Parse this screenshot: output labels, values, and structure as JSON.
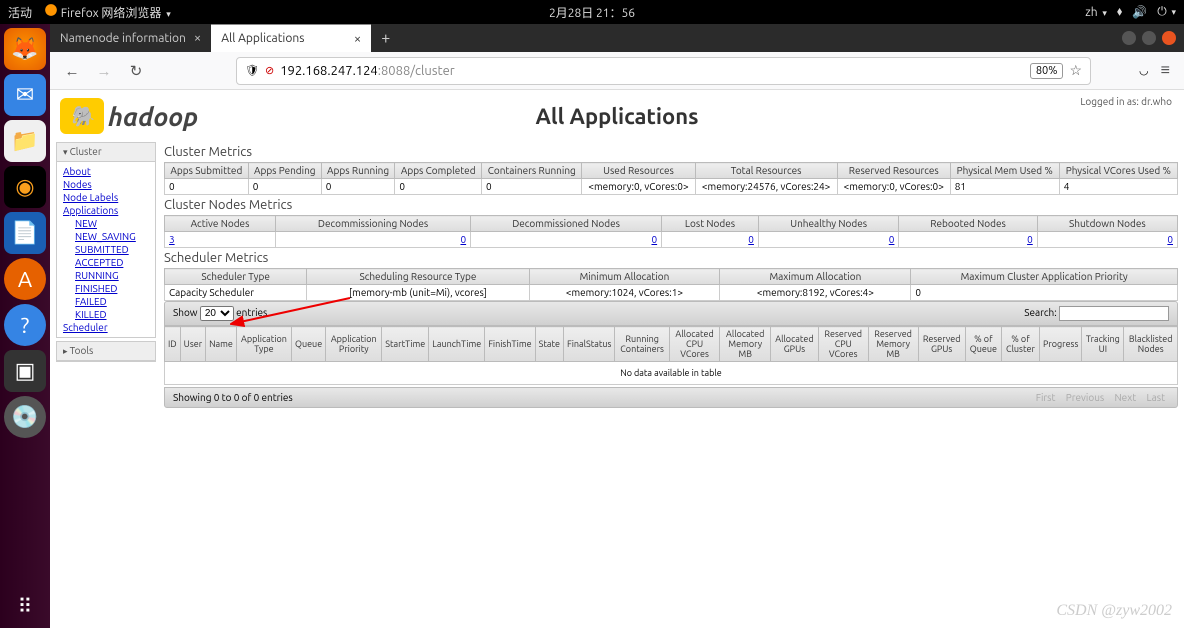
{
  "topbar": {
    "activities": "活动",
    "app_label": "Firefox 网络浏览器",
    "datetime": "2月28日  21：56",
    "lang": "zh"
  },
  "tabs": [
    {
      "title": "Namenode information",
      "active": false
    },
    {
      "title": "All Applications",
      "active": true
    }
  ],
  "url": {
    "host": "192.168.247.124",
    "port_path": ":8088/cluster",
    "zoom": "80%"
  },
  "login_info": "Logged in as: dr.who",
  "page_title": "All Applications",
  "sidebar": {
    "cluster_head": "Cluster",
    "links": [
      "About",
      "Nodes",
      "Node Labels",
      "Applications"
    ],
    "app_states": [
      "NEW",
      "NEW_SAVING",
      "SUBMITTED",
      "ACCEPTED",
      "RUNNING",
      "FINISHED",
      "FAILED",
      "KILLED"
    ],
    "scheduler": "Scheduler",
    "tools_head": "Tools"
  },
  "cluster_metrics": {
    "title": "Cluster Metrics",
    "headers": [
      "Apps Submitted",
      "Apps Pending",
      "Apps Running",
      "Apps Completed",
      "Containers Running",
      "Used Resources",
      "Total Resources",
      "Reserved Resources",
      "Physical Mem Used %",
      "Physical VCores Used %"
    ],
    "values": [
      "0",
      "0",
      "0",
      "0",
      "0",
      "<memory:0, vCores:0>",
      "<memory:24576, vCores:24>",
      "<memory:0, vCores:0>",
      "81",
      "4"
    ]
  },
  "nodes_metrics": {
    "title": "Cluster Nodes Metrics",
    "headers": [
      "Active Nodes",
      "Decommissioning Nodes",
      "Decommissioned Nodes",
      "Lost Nodes",
      "Unhealthy Nodes",
      "Rebooted Nodes",
      "Shutdown Nodes"
    ],
    "values": [
      "3",
      "0",
      "0",
      "0",
      "0",
      "0",
      "0"
    ]
  },
  "scheduler_metrics": {
    "title": "Scheduler Metrics",
    "headers": [
      "Scheduler Type",
      "Scheduling Resource Type",
      "Minimum Allocation",
      "Maximum Allocation",
      "Maximum Cluster Application Priority"
    ],
    "values": [
      "Capacity Scheduler",
      "[memory-mb (unit=Mi), vcores]",
      "<memory:1024, vCores:1>",
      "<memory:8192, vCores:4>",
      "0"
    ]
  },
  "datatable": {
    "show_label": "Show",
    "show_value": "20",
    "entries_label": "entries",
    "search_label": "Search:",
    "headers": [
      "ID",
      "User",
      "Name",
      "Application Type",
      "Queue",
      "Application Priority",
      "StartTime",
      "LaunchTime",
      "FinishTime",
      "State",
      "FinalStatus",
      "Running Containers",
      "Allocated CPU VCores",
      "Allocated Memory MB",
      "Allocated GPUs",
      "Reserved CPU VCores",
      "Reserved Memory MB",
      "Reserved GPUs",
      "% of Queue",
      "% of Cluster",
      "Progress",
      "Tracking UI",
      "Blacklisted Nodes"
    ],
    "no_data": "No data available in table",
    "info": "Showing 0 to 0 of 0 entries",
    "pager": [
      "First",
      "Previous",
      "Next",
      "Last"
    ]
  },
  "watermark": "CSDN @zyw2002"
}
